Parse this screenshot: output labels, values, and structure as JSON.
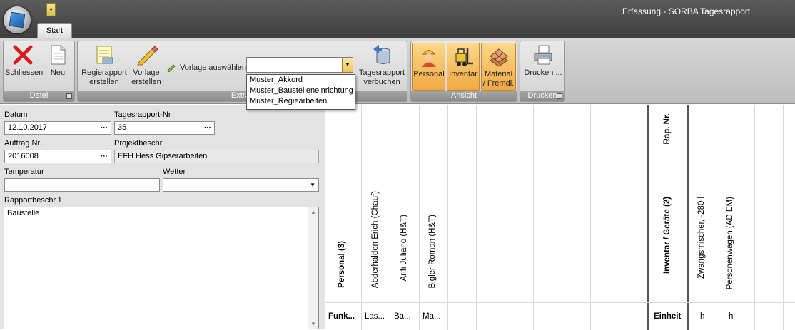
{
  "app": {
    "title": "Erfassung - SORBA Tagesrapport",
    "qat_glyph": "▾"
  },
  "tabs": [
    {
      "label": "Start"
    }
  ],
  "ribbon": {
    "groups": {
      "datei": "Datei",
      "extras": "Extras",
      "ansicht": "Ansicht",
      "drucken": "Drucken"
    },
    "buttons": {
      "schliessen": "Schliessen",
      "neu": "Neu",
      "regierapport_l1": "Regierapport",
      "regierapport_l2": "erstellen",
      "vorlage_l1": "Vorlage",
      "vorlage_l2": "erstellen",
      "vorlage_auswaehlen": "Vorlage auswählen",
      "verbuchen_l1": "Tagesrapport",
      "verbuchen_l2": "verbuchen",
      "personal": "Personal",
      "inventar": "Inventar",
      "material_l1": "Material",
      "material_l2": "/ Fremdl.",
      "drucken": "Drucken ..."
    },
    "vorlage_combo": {
      "value": "",
      "options": [
        "Muster_Akkord",
        "Muster_Baustelleneinrichtung",
        "Muster_Regiearbeiten"
      ]
    }
  },
  "form": {
    "datum": {
      "label": "Datum",
      "value": "12.10.2017"
    },
    "tagesrapport_nr": {
      "label": "Tagesrapport-Nr",
      "value": "35"
    },
    "auftrag_nr": {
      "label": "Auftrag Nr.",
      "value": "2016008"
    },
    "projektbeschr": {
      "label": "Projektbeschr.",
      "value": "EFH Hess Gipserarbeiten"
    },
    "temperatur": {
      "label": "Temperatur",
      "value": ""
    },
    "wetter": {
      "label": "Wetter",
      "value": ""
    },
    "rapportbeschr": {
      "label": "Rapportbeschr.1",
      "value": "Baustelle"
    },
    "dots": "···"
  },
  "grid": {
    "personal_header": "Personal (3)",
    "personal_row_label": "Funk...",
    "personal": [
      {
        "name": "Abderhalden Erich (Chauf)",
        "value": "Las..."
      },
      {
        "name": "Arifi Juliano (H&T)",
        "value": "Ba..."
      },
      {
        "name": "Bigler Roman (H&T)",
        "value": "Ma..."
      }
    ],
    "rap_nr_header": "Rap. Nr.",
    "inventar_header": "Inventar / Geräte (2)",
    "inventar_row_label": "Einheit",
    "inventar": [
      {
        "name": "Zwangsmischer, -280 l",
        "value": "h"
      },
      {
        "name": "Personenwagen (AD EM)",
        "value": "h"
      }
    ]
  }
}
